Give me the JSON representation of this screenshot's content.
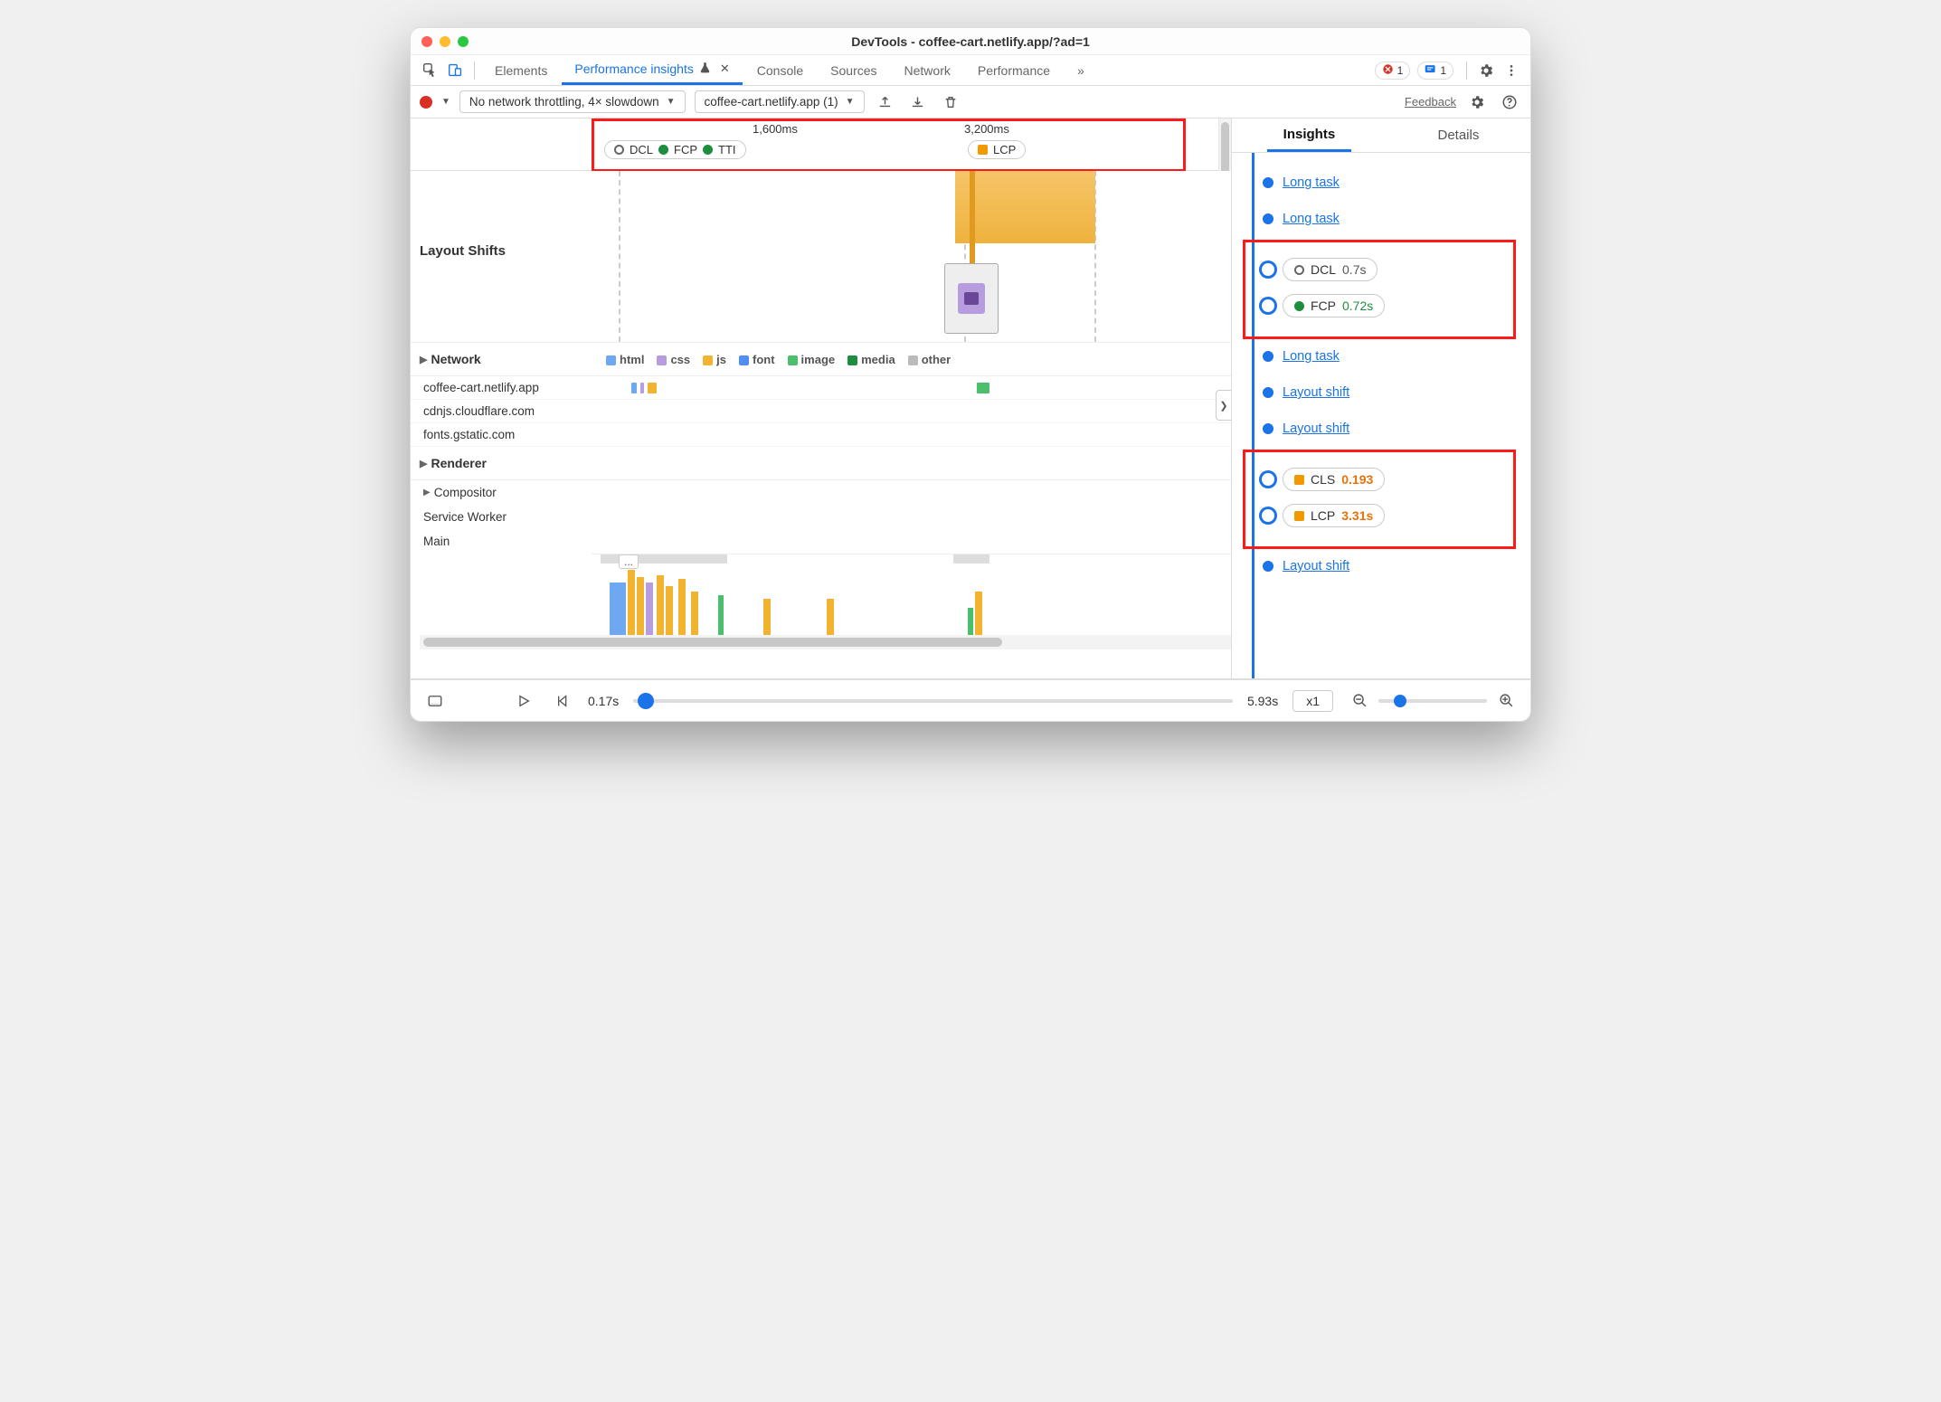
{
  "window": {
    "title": "DevTools - coffee-cart.netlify.app/?ad=1"
  },
  "panelTabs": {
    "elements": "Elements",
    "perfInsights": "Performance insights",
    "console": "Console",
    "sources": "Sources",
    "network": "Network",
    "performance": "Performance",
    "more": "»"
  },
  "badges": {
    "errors": "1",
    "info": "1"
  },
  "toolbar": {
    "throttling": "No network throttling, 4× slowdown",
    "recording": "coffee-cart.netlify.app (1)",
    "feedback": "Feedback"
  },
  "timeline": {
    "tick1": "1,600ms",
    "tick2": "3,200ms",
    "pills": {
      "dcl": "DCL",
      "fcp": "FCP",
      "tti": "TTI",
      "lcp": "LCP"
    }
  },
  "tracks": {
    "layoutShifts": "Layout Shifts",
    "network": "Network",
    "renderer": "Renderer",
    "compositor": "Compositor",
    "serviceWorker": "Service Worker",
    "main": "Main"
  },
  "netLegend": {
    "html": "html",
    "css": "css",
    "js": "js",
    "font": "font",
    "image": "image",
    "media": "media",
    "other": "other"
  },
  "netHosts": {
    "h1": "coffee-cart.netlify.app",
    "h2": "cdnjs.cloudflare.com",
    "h3": "fonts.gstatic.com"
  },
  "rightTabs": {
    "insights": "Insights",
    "details": "Details"
  },
  "insights": {
    "longTask": "Long task",
    "layoutShift": "Layout shift",
    "dcl": {
      "label": "DCL",
      "value": "0.7s"
    },
    "fcp": {
      "label": "FCP",
      "value": "0.72s"
    },
    "cls": {
      "label": "CLS",
      "value": "0.193"
    },
    "lcp": {
      "label": "LCP",
      "value": "3.31s"
    }
  },
  "bottom": {
    "tStart": "0.17s",
    "tEnd": "5.93s",
    "speed": "x1"
  },
  "ellipsis": "..."
}
